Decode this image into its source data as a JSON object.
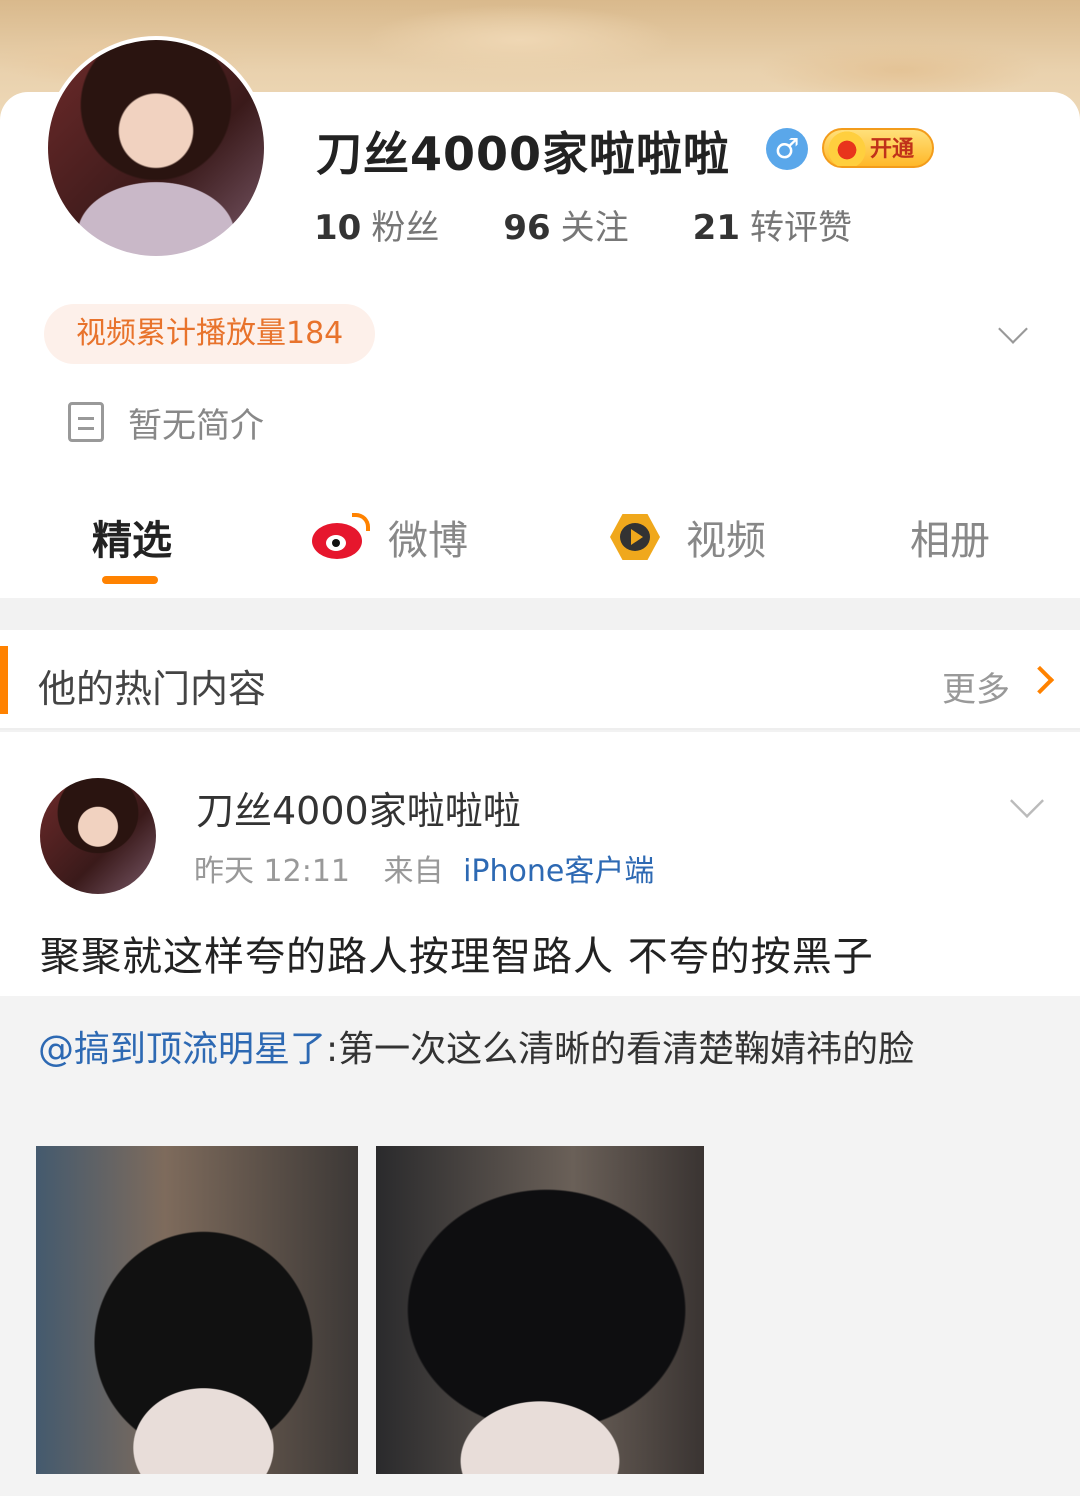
{
  "profile": {
    "username": "刀丝4000家啦啦啦",
    "gender_symbol": "♂",
    "vip_label": "开通",
    "stats": [
      {
        "num": "10",
        "label": "粉丝"
      },
      {
        "num": "96",
        "label": "关注"
      },
      {
        "num": "21",
        "label": "转评赞"
      }
    ],
    "video_plays": "视频累计播放量184",
    "bio": "暂无简介"
  },
  "tabs": [
    {
      "label": "精选",
      "active": true
    },
    {
      "label": "微博",
      "icon": "weibo-icon"
    },
    {
      "label": "视频",
      "icon": "video-icon"
    },
    {
      "label": "相册"
    }
  ],
  "section": {
    "title": "他的热门内容",
    "more": "更多"
  },
  "post": {
    "author": "刀丝4000家啦啦啦",
    "time": "昨天 12:11",
    "from_label": "来自",
    "source": "iPhone客户端",
    "text": "聚聚就这样夸的路人按理智路人 不夸的按黑子"
  },
  "repost": {
    "mention": "@搞到顶流明星了",
    "text": ":第一次这么清晰的看清楚鞠婧祎的脸"
  },
  "colors": {
    "accent": "#ff8200",
    "link": "#2d69b3"
  }
}
